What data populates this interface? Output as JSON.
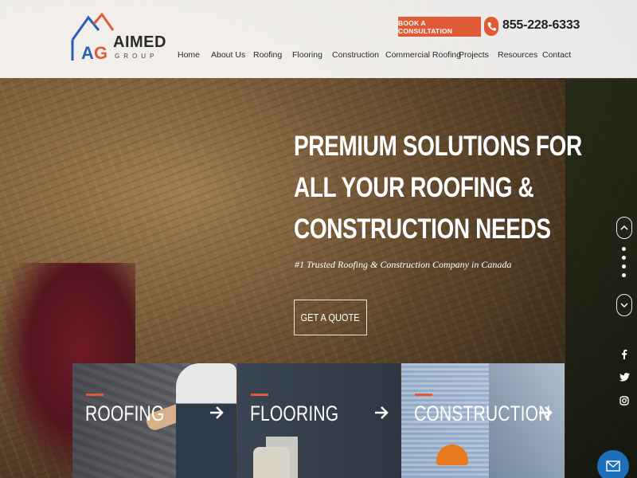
{
  "brand": {
    "logo_letters": "AG",
    "name": "AIMED",
    "tagline": "GROUP"
  },
  "header": {
    "consult_button": "BOOK A CONSULTATION",
    "phone": "855-228-6333"
  },
  "nav": {
    "items": [
      {
        "label": "Home"
      },
      {
        "label": "About Us"
      },
      {
        "label": "Roofing"
      },
      {
        "label": "Flooring"
      },
      {
        "label": "Construction"
      },
      {
        "label": "Commercial Roofing"
      },
      {
        "label": "Projects"
      },
      {
        "label": "Resources"
      },
      {
        "label": "Contact"
      }
    ]
  },
  "hero": {
    "title_lines": [
      "PREMIUM SOLUTIONS FOR",
      "ALL YOUR ROOFING &",
      "CONSTRUCTION NEEDS"
    ],
    "subtitle": "#1 Trusted Roofing & Construction Company in Canada",
    "cta": "GET A QUOTE"
  },
  "slider": {
    "up_icon": "chevron-up-icon",
    "down_icon": "chevron-down-icon",
    "dot_count": 4
  },
  "social": {
    "icons": [
      "facebook-icon",
      "twitter-icon",
      "instagram-icon"
    ]
  },
  "services": [
    {
      "label": "ROOFING"
    },
    {
      "label": "FLOORING"
    },
    {
      "label": "CONSTRUCTION"
    }
  ],
  "colors": {
    "accent": "#e15a36",
    "logo_blue": "#2a5fb4",
    "mail_button": "#1d6fb8"
  }
}
